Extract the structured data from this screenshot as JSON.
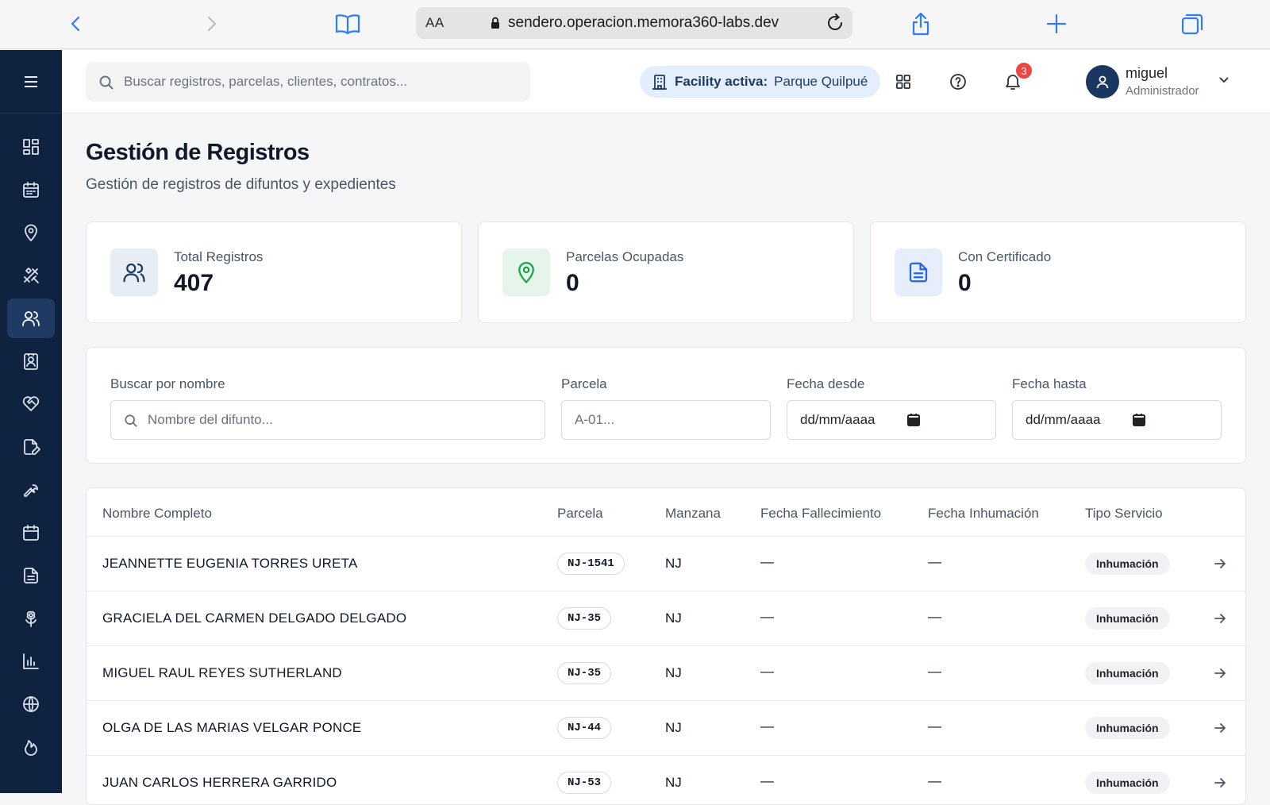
{
  "browser": {
    "aa_label": "AA",
    "url": "sendero.operacion.memora360-labs.dev"
  },
  "topbar": {
    "search_placeholder": "Buscar registros, parcelas, clientes, contratos...",
    "facility_label": "Facility activa:",
    "facility_value": "Parque Quilpué",
    "notifications_count": "3",
    "user_name": "miguel",
    "user_role": "Administrador"
  },
  "sidebar": {
    "items": [
      {
        "icon": "dashboard-icon"
      },
      {
        "icon": "calendar-icon"
      },
      {
        "icon": "map-pin-icon"
      },
      {
        "icon": "tools-icon"
      },
      {
        "icon": "users-icon",
        "active": true
      },
      {
        "icon": "contact-card-icon"
      },
      {
        "icon": "heart-handshake-icon"
      },
      {
        "icon": "edit-document-icon"
      },
      {
        "icon": "wrench-icon"
      },
      {
        "icon": "calendar-icon"
      },
      {
        "icon": "document-icon"
      },
      {
        "icon": "flower-icon"
      },
      {
        "icon": "bar-chart-icon"
      },
      {
        "icon": "globe-icon"
      },
      {
        "icon": "flame-icon"
      }
    ]
  },
  "page": {
    "title": "Gestión de Registros",
    "subtitle": "Gestión de registros de difuntos y expedientes"
  },
  "stats": [
    {
      "label": "Total Registros",
      "value": "407",
      "icon": "users-icon",
      "color": "#1e3a5f",
      "bg": "#e8edf5"
    },
    {
      "label": "Parcelas Ocupadas",
      "value": "0",
      "icon": "map-pin-icon",
      "color": "#16a34a",
      "bg": "#e6f5ec"
    },
    {
      "label": "Con Certificado",
      "value": "0",
      "icon": "document-icon",
      "color": "#2563eb",
      "bg": "#e6eefc"
    }
  ],
  "filters": {
    "name_label": "Buscar por nombre",
    "name_placeholder": "Nombre del difunto...",
    "parcela_label": "Parcela",
    "parcela_placeholder": "A-01...",
    "date_from_label": "Fecha desde",
    "date_from_value": "dd/mm/aaaa",
    "date_to_label": "Fecha hasta",
    "date_to_value": "dd/mm/aaaa"
  },
  "table": {
    "headers": [
      "Nombre Completo",
      "Parcela",
      "Manzana",
      "Fecha Fallecimiento",
      "Fecha Inhumación",
      "Tipo Servicio"
    ],
    "rows": [
      {
        "name": "JEANNETTE EUGENIA TORRES URETA",
        "parcela": "NJ-1541",
        "manzana": "NJ",
        "fallecimiento": "—",
        "inhumacion": "—",
        "tipo": "Inhumación"
      },
      {
        "name": "GRACIELA DEL CARMEN DELGADO DELGADO",
        "parcela": "NJ-35",
        "manzana": "NJ",
        "fallecimiento": "—",
        "inhumacion": "—",
        "tipo": "Inhumación"
      },
      {
        "name": "MIGUEL RAUL REYES SUTHERLAND",
        "parcela": "NJ-35",
        "manzana": "NJ",
        "fallecimiento": "—",
        "inhumacion": "—",
        "tipo": "Inhumación"
      },
      {
        "name": "OLGA DE LAS MARIAS VELGAR PONCE",
        "parcela": "NJ-44",
        "manzana": "NJ",
        "fallecimiento": "—",
        "inhumacion": "—",
        "tipo": "Inhumación"
      },
      {
        "name": "JUAN CARLOS HERRERA GARRIDO",
        "parcela": "NJ-53",
        "manzana": "NJ",
        "fallecimiento": "—",
        "inhumacion": "—",
        "tipo": "Inhumación"
      }
    ]
  }
}
